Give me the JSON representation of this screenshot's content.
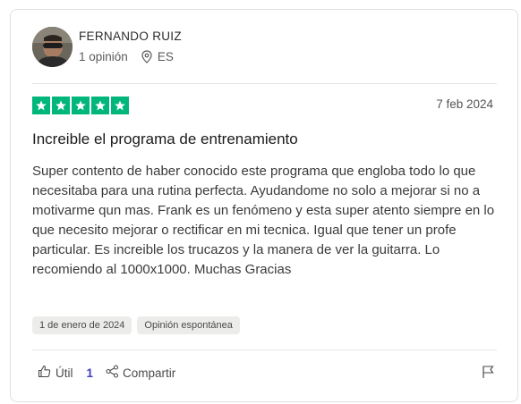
{
  "reviewer": {
    "name": "FERNANDO RUIZ",
    "review_count": "1 opinión",
    "country": "ES"
  },
  "review": {
    "rating": 5,
    "rating_max": 5,
    "date": "7 feb 2024",
    "title": "Increible el programa de entrenamiento",
    "body": "Super contento de haber conocido este programa que engloba todo lo que necesitaba para una rutina perfecta. Ayudandome no solo a mejorar si no a motivarme qun mas. Frank es un fenómeno y esta super atento siempre en lo que necesito mejorar o rectificar en mi tecnica. Igual que tener un profe particular. Es increible los trucazos y la manera de ver la guitarra. Lo recomiendo al 1000x1000. Muchas Gracias",
    "tags": [
      "1 de enero de 2024",
      "Opinión espontánea"
    ]
  },
  "actions": {
    "useful_label": "Útil",
    "useful_count": "1",
    "share_label": "Compartir"
  },
  "colors": {
    "star_green": "#00b67a",
    "count_accent": "#3f3fbf"
  }
}
